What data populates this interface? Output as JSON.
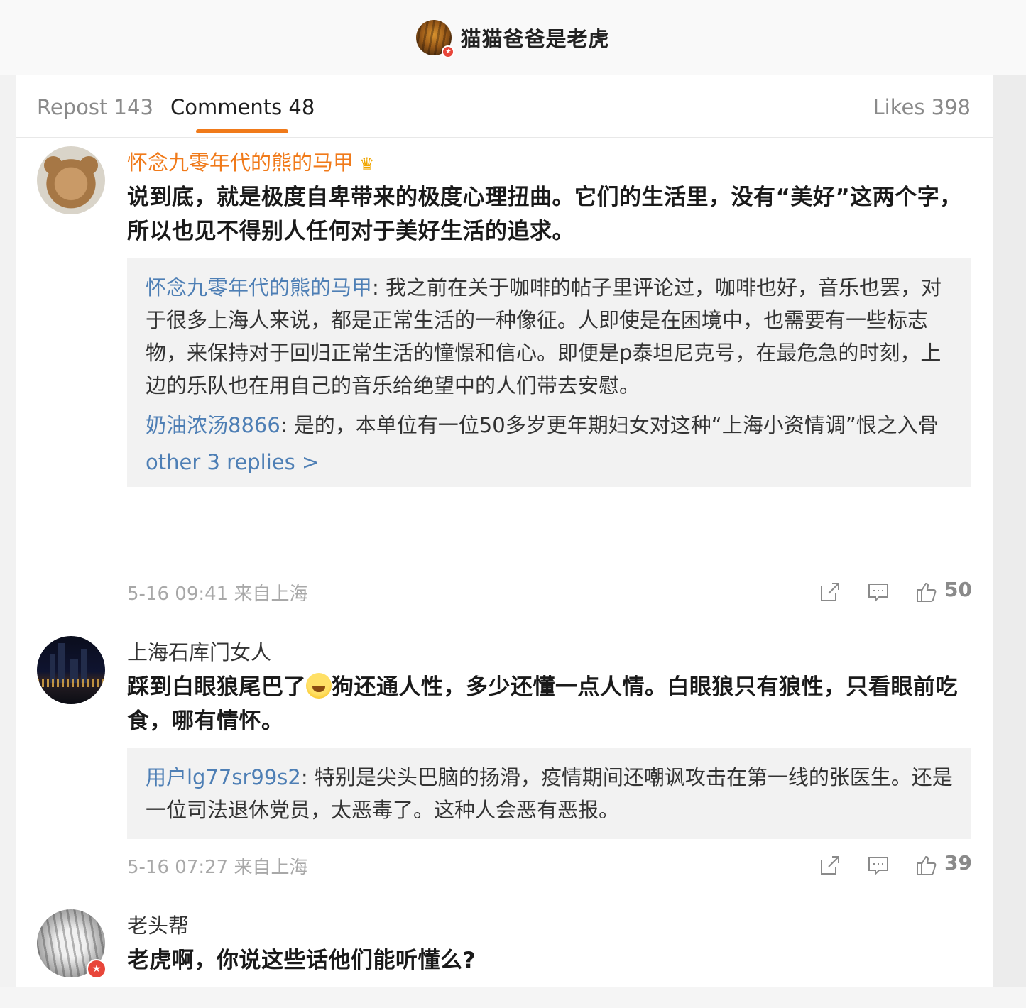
{
  "header": {
    "title": "猫猫爸爸是老虎"
  },
  "tabs": {
    "repost": "Repost 143",
    "comments": "Comments 48",
    "likes": "Likes 398"
  },
  "comments": [
    {
      "user": "怀念九零年代的熊的马甲",
      "text": "说到底，就是极度自卑带来的极度心理扭曲。它们的生活里，没有“美好”这两个字，所以也见不得别人任何对于美好生活的追求。",
      "replies": [
        {
          "user": "怀念九零年代的熊的马甲",
          "text": ": 我之前在关于咖啡的帖子里评论过，咖啡也好，音乐也罢，对于很多上海人来说，都是正常生活的一种像征。人即使是在困境中，也需要有一些标志物，来保持对于回归正常生活的憧憬和信心。即便是p泰坦尼克号，在最危急的时刻，上边的乐队也在用自己的音乐给绝望中的人们带去安慰。"
        },
        {
          "user": "奶油浓汤8866",
          "text": ": 是的，本单位有一位50多岁更年期妇女对这种“上海小资情调”恨之入骨"
        }
      ],
      "more": "other 3 replies >",
      "time": "5-16 09:41 来自上海",
      "likes": "50"
    },
    {
      "user": "上海石库门女人",
      "text_before": "踩到白眼狼尾巴了",
      "text_after": "狗还通人性，多少还懂一点人情。白眼狼只有狼性，只看眼前吃食，哪有情怀。",
      "replies": [
        {
          "user": "用户lg77sr99s2",
          "text": ": 特别是尖头巴脑的扬滑，疫情期间还嘲讽攻击在第一线的张医生。还是一位司法退休党员，太恶毒了。这种人会恶有恶报。"
        }
      ],
      "time": "5-16 07:27 来自上海",
      "likes": "39"
    },
    {
      "user": "老头帮",
      "text": "老虎啊，你说这些话他们能听懂么?"
    }
  ],
  "icons": {
    "share": "share-icon",
    "comment": "comment-icon",
    "like": "thumbs-up-icon",
    "vip": "crown-icon",
    "verified": "verified-badge-icon"
  },
  "colors": {
    "accent": "#f07a1a",
    "link": "#4e7fb5",
    "muted": "#a8a8a8",
    "verified": "#e8463a"
  }
}
